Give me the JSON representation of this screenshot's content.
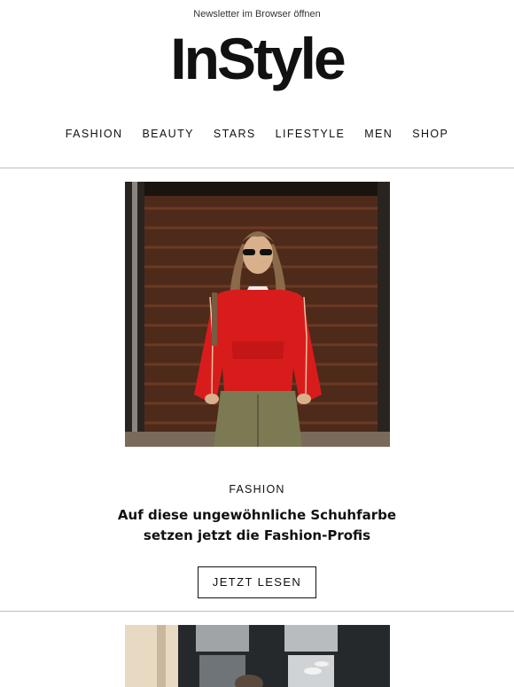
{
  "header": {
    "browser_link": "Newsletter im Browser öffnen",
    "logo_text": "InStyle"
  },
  "nav": {
    "items": [
      "FASHION",
      "BEAUTY",
      "STARS",
      "LIFESTYLE",
      "MEN",
      "SHOP"
    ]
  },
  "article": {
    "category": "FASHION",
    "headline_line1": "Auf diese ungewöhnliche Schuhfarbe",
    "headline_line2": "setzen jetzt die Fashion-Profis",
    "cta": "JETZT LESEN"
  }
}
